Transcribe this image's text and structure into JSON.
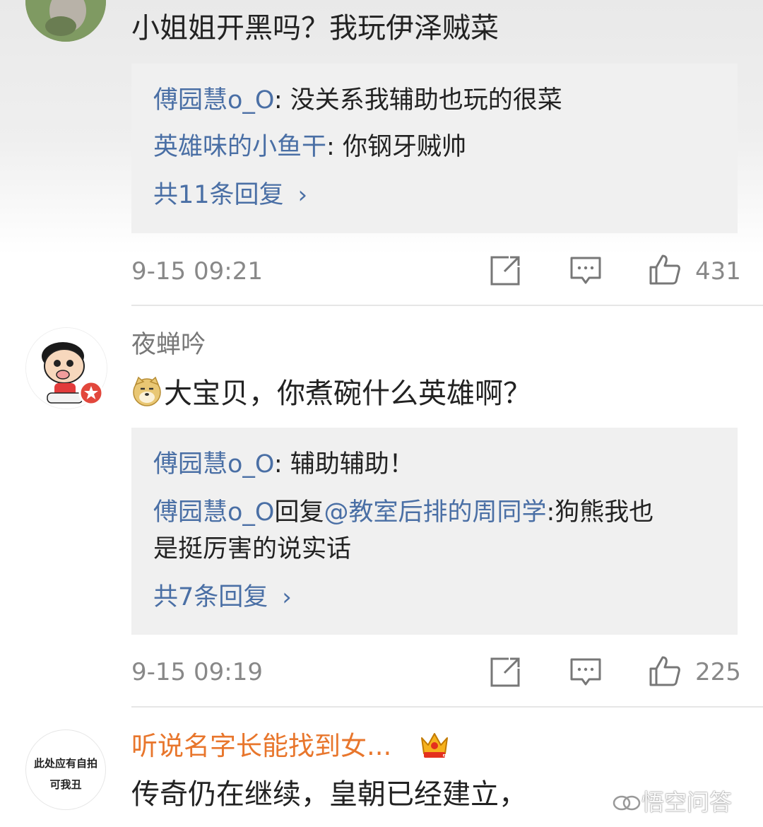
{
  "comments": [
    {
      "text": "小姐姐开黑吗？我玩伊泽贼菜",
      "replies": [
        {
          "name": "傅园慧o_O",
          "sep": ": ",
          "text": "没关系我辅助也玩的很菜"
        },
        {
          "name": "英雄味的小鱼干",
          "sep": ": ",
          "text": "你钢牙贼帅"
        }
      ],
      "more_replies": "共11条回复",
      "time": "9-15 09:21",
      "likes": "431"
    },
    {
      "username": "夜蝉吟",
      "emoji": "doge-emoji",
      "text": "大宝贝，你煮碗什么英雄啊？",
      "replies": [
        {
          "name": "傅园慧o_O",
          "sep": ": ",
          "text": "辅助辅助！"
        },
        {
          "name": "傅园慧o_O",
          "mid": "回复",
          "mention": "@教室后排的周同学",
          "sep": ":",
          "text_line1": "狗熊我也",
          "text_line2": "是挺厉害的说实话"
        }
      ],
      "more_replies": "共7条回复",
      "time": "9-15 09:19",
      "likes": "225"
    },
    {
      "username": "听说名字长能找到女...",
      "avatar_text_line1": "此处应有自拍",
      "avatar_text_line2": "可我丑",
      "badge": "crown-vip-icon",
      "text": "传奇仍在继续，皇朝已经建立，"
    }
  ],
  "watermark": "悟空问答",
  "colors": {
    "link": "#4a6fa5",
    "vip_name": "#e8762c",
    "muted": "#888888"
  }
}
